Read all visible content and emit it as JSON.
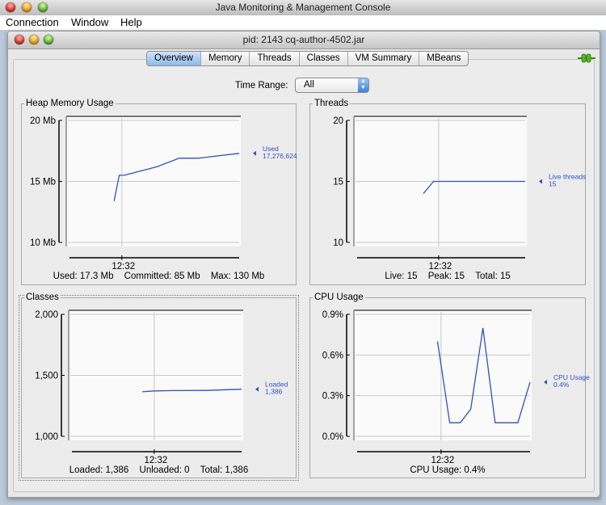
{
  "app": {
    "title": "Java Monitoring & Management Console",
    "menu": [
      "Connection",
      "Window",
      "Help"
    ]
  },
  "window": {
    "title": "pid: 2143 cq-author-4502.jar",
    "tabs": [
      {
        "label": "Overview",
        "active": true
      },
      {
        "label": "Memory",
        "active": false
      },
      {
        "label": "Threads",
        "active": false
      },
      {
        "label": "Classes",
        "active": false
      },
      {
        "label": "VM Summary",
        "active": false
      },
      {
        "label": "MBeans",
        "active": false
      }
    ],
    "connection_icon": "plug-connected-icon",
    "time_range": {
      "label": "Time Range:",
      "value": "All"
    }
  },
  "colors": {
    "series": "#3050c0",
    "grid": "#c8c8c8",
    "plot_bg": "#fafafa"
  },
  "panels": {
    "heap": {
      "title": "Heap Memory Usage",
      "summary": [
        "Used: 17.3 Mb",
        "Committed: 85 Mb",
        "Max: 130 Mb"
      ]
    },
    "threads": {
      "title": "Threads",
      "summary": [
        "Live: 15",
        "Peak: 15",
        "Total: 15"
      ]
    },
    "classes": {
      "title": "Classes",
      "summary": [
        "Loaded: 1,386",
        "Unloaded: 0",
        "Total: 1,386"
      ]
    },
    "cpu": {
      "title": "CPU Usage",
      "summary": [
        "CPU Usage: 0.4%"
      ]
    }
  },
  "chart_data": [
    {
      "id": "heap",
      "type": "line",
      "title": "Heap Memory Usage",
      "ylim": [
        10,
        20
      ],
      "yticks": [
        10,
        15,
        20
      ],
      "ytick_labels": [
        "10 Mb",
        "15 Mb",
        "20 Mb"
      ],
      "xtick_labels": [
        "12:32"
      ],
      "xlim": [
        0,
        10
      ],
      "xtick_pos": [
        3.15
      ],
      "grid": true,
      "series": [
        {
          "name": "Used",
          "legend_value": "17,276,624",
          "x": [
            2.7,
            3.0,
            3.3,
            5.2,
            6.5,
            7.6,
            10
          ],
          "y": [
            13.4,
            15.5,
            15.5,
            16.2,
            16.9,
            16.9,
            17.3
          ]
        }
      ]
    },
    {
      "id": "threads",
      "type": "line",
      "title": "Threads",
      "ylim": [
        10,
        20
      ],
      "yticks": [
        10,
        15,
        20
      ],
      "ytick_labels": [
        "10",
        "15",
        "20"
      ],
      "xtick_labels": [
        "12:32"
      ],
      "xlim": [
        0,
        10
      ],
      "xtick_pos": [
        4.9
      ],
      "grid": true,
      "series": [
        {
          "name": "Live threads",
          "legend_value": "15",
          "x": [
            4.0,
            4.6,
            10
          ],
          "y": [
            14.0,
            15.0,
            15.0
          ]
        }
      ]
    },
    {
      "id": "classes",
      "type": "line",
      "title": "Classes",
      "ylim": [
        1000,
        2000
      ],
      "yticks": [
        1000,
        1500,
        2000
      ],
      "ytick_labels": [
        "1,000",
        "1,500",
        "2,000"
      ],
      "xtick_labels": [
        "12:32"
      ],
      "xlim": [
        0,
        10
      ],
      "xtick_pos": [
        4.9
      ],
      "grid": true,
      "series": [
        {
          "name": "Loaded",
          "legend_value": "1,386",
          "x": [
            4.2,
            4.9,
            6.0,
            8.0,
            10
          ],
          "y": [
            1365,
            1372,
            1375,
            1376,
            1386
          ]
        }
      ]
    },
    {
      "id": "cpu",
      "type": "line",
      "title": "CPU Usage",
      "ylim": [
        0.0,
        0.9
      ],
      "yticks": [
        0.0,
        0.3,
        0.6,
        0.9
      ],
      "ytick_labels": [
        "0.0%",
        "0.3%",
        "0.6%",
        "0.9%"
      ],
      "xtick_labels": [
        "12:32"
      ],
      "xlim": [
        0,
        10
      ],
      "xtick_pos": [
        4.9
      ],
      "grid": true,
      "series": [
        {
          "name": "CPU Usage",
          "legend_value": "0.4%",
          "x": [
            4.7,
            5.4,
            6.0,
            6.6,
            7.3,
            8.0,
            9.3,
            10
          ],
          "y": [
            0.7,
            0.1,
            0.1,
            0.2,
            0.8,
            0.1,
            0.1,
            0.4
          ]
        }
      ]
    }
  ]
}
